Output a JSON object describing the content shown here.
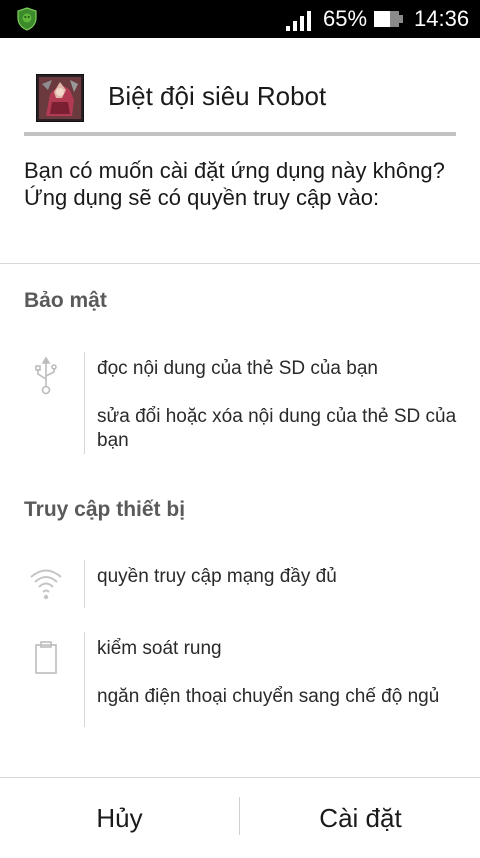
{
  "status_bar": {
    "battery": "65%",
    "time": "14:36",
    "left_icon": "shield-notification-icon",
    "signal_icon": "signal-icon",
    "battery_icon": "battery-icon"
  },
  "header": {
    "app_name": "Biệt đội siêu Robot",
    "app_icon": "app-robot-icon"
  },
  "prompt": "Bạn có muốn cài đặt ứng dụng này không? Ứng dụng sẽ có quyền truy cập vào:",
  "sections": [
    {
      "title": "Bảo mật",
      "groups": [
        {
          "icon": "usb-icon",
          "items": [
            "đọc nội dung của thẻ SD của bạn",
            "sửa đổi hoặc xóa nội dung của thẻ SD của bạn"
          ]
        }
      ]
    },
    {
      "title": "Truy cập thiết bị",
      "groups": [
        {
          "icon": "wifi-icon",
          "items": [
            "quyền truy cập mạng đầy đủ"
          ]
        },
        {
          "icon": "clipboard-icon",
          "items": [
            "kiểm soát rung",
            "ngăn điện thoại chuyển sang chế độ ngủ"
          ]
        }
      ]
    }
  ],
  "buttons": {
    "cancel": "Hủy",
    "install": "Cài đặt"
  },
  "colors": {
    "status_bar": "#000000",
    "header_divider": "#c2c2c2",
    "section_title": "#5a5a5a",
    "icon_gray": "#bdbdbd"
  }
}
